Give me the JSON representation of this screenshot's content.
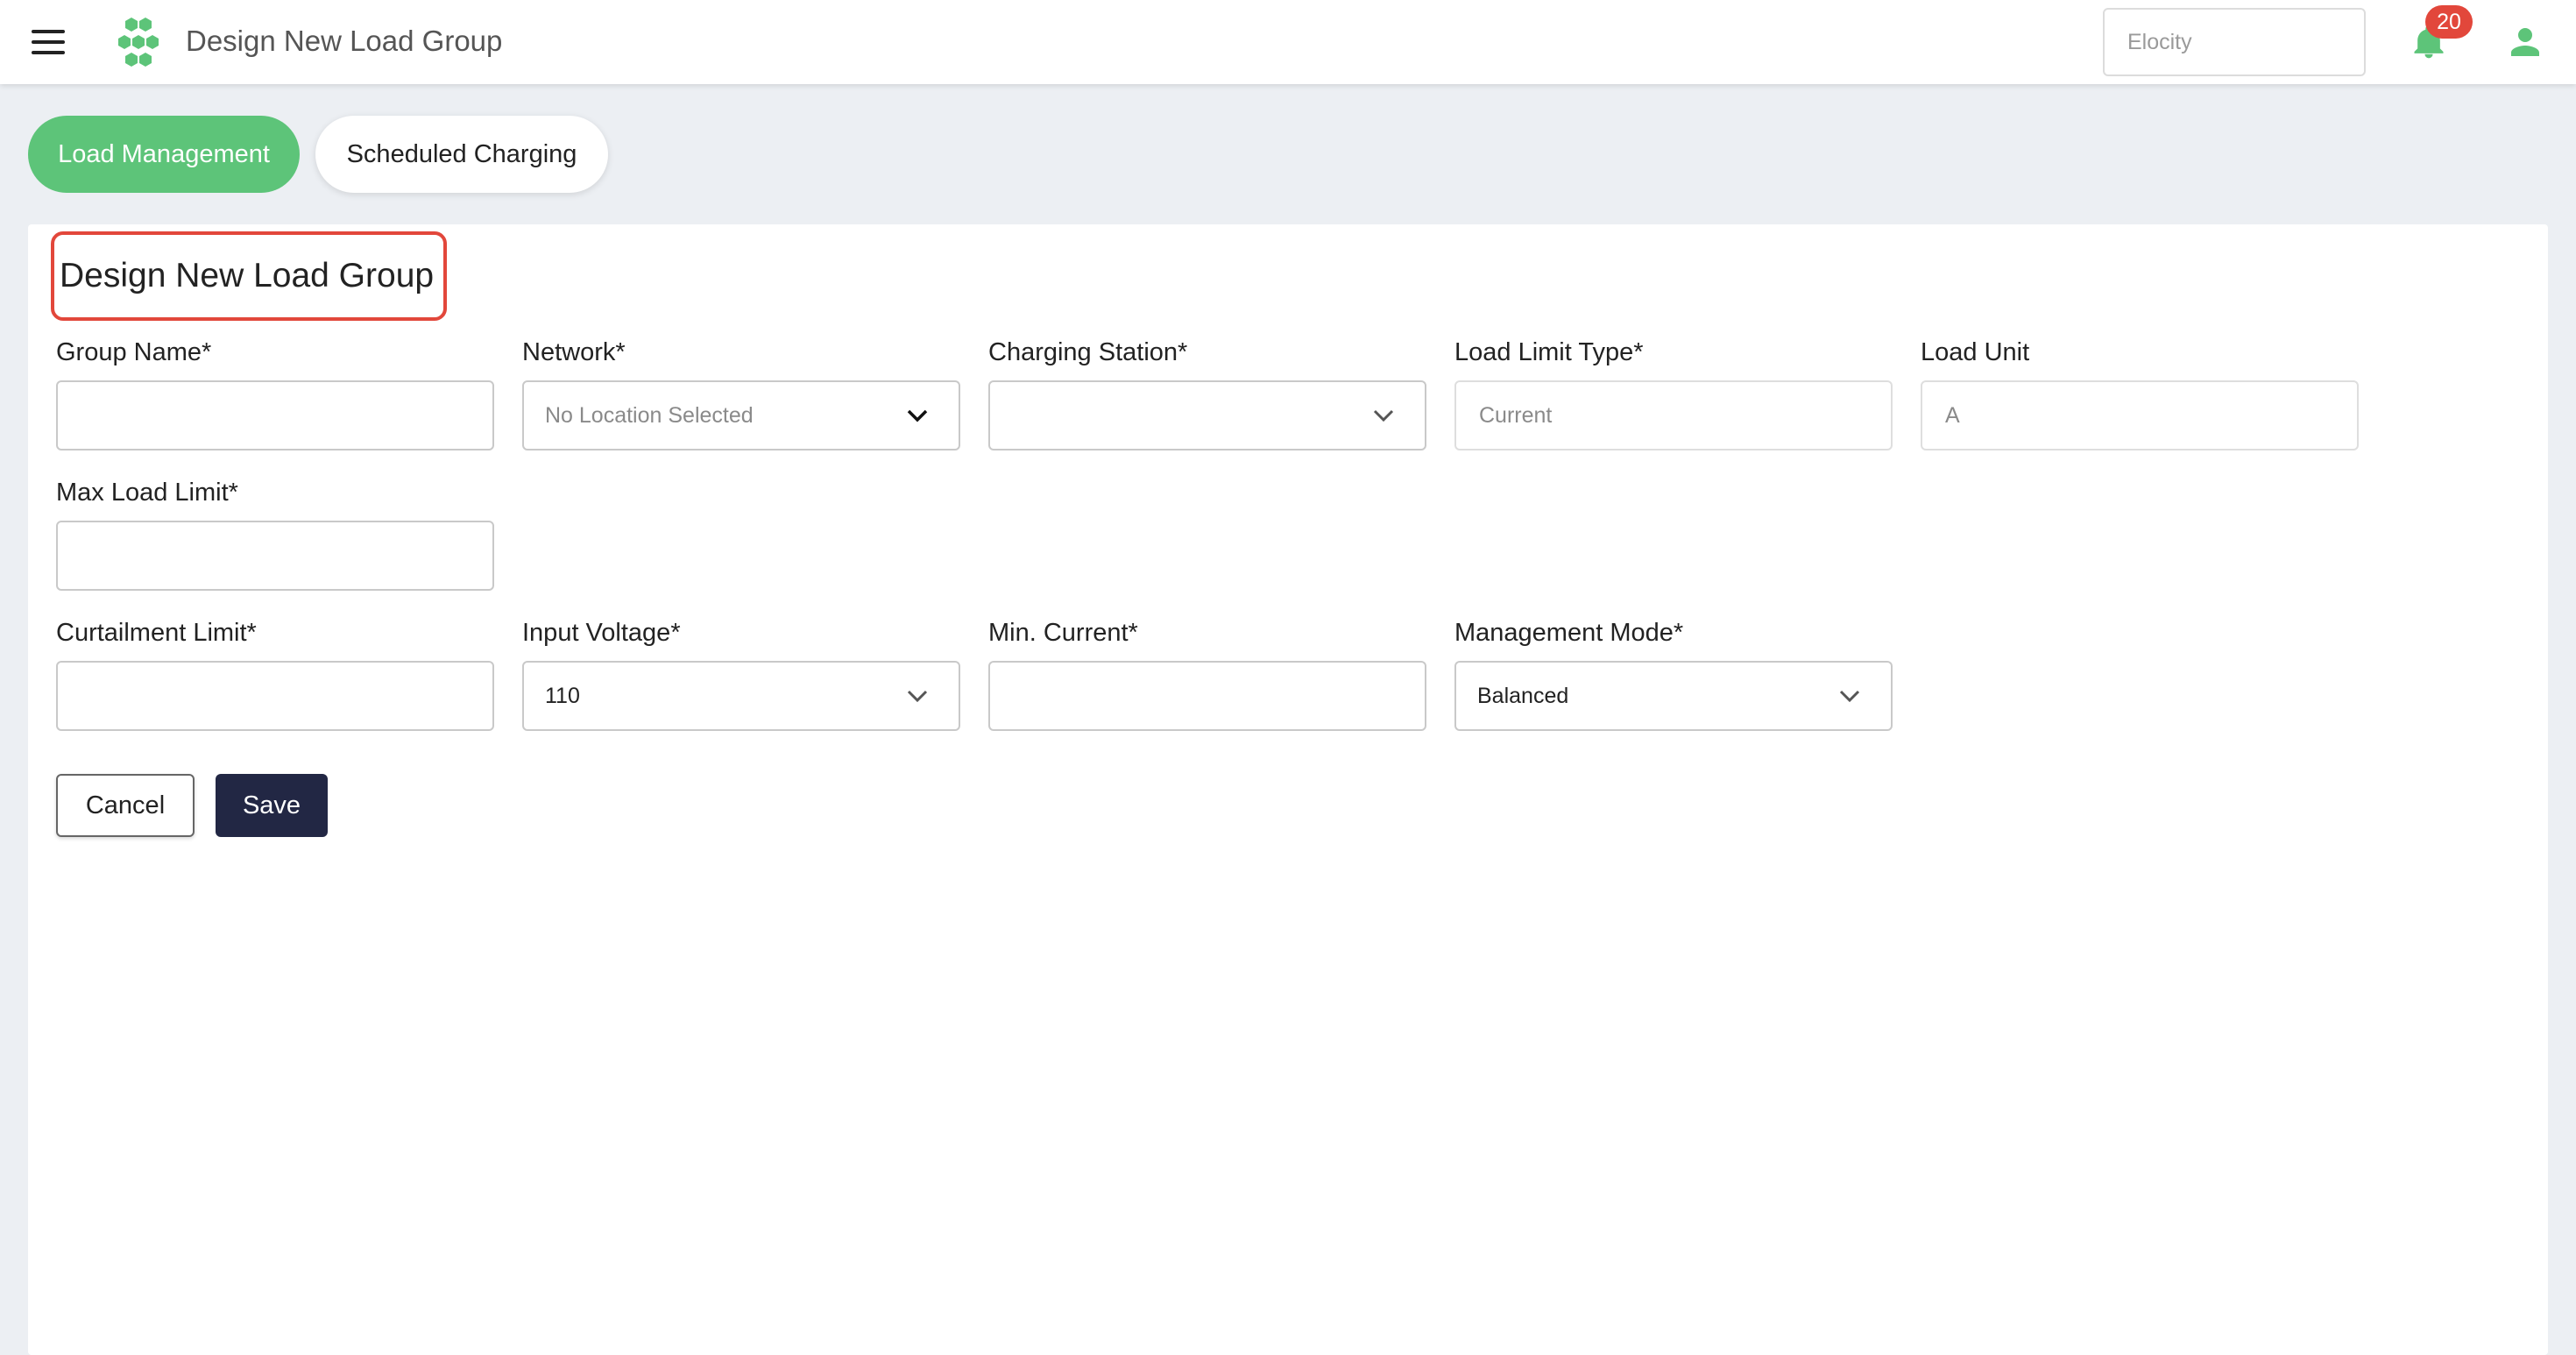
{
  "header": {
    "title": "Design New Load Group",
    "search_placeholder": "Elocity",
    "notification_count": "20",
    "brand_color": "#5dc479"
  },
  "tabs": [
    {
      "label": "Load Management",
      "active": true
    },
    {
      "label": "Scheduled Charging",
      "active": false
    }
  ],
  "form": {
    "title": "Design New Load Group",
    "group_name": {
      "label": "Group Name*",
      "value": ""
    },
    "network": {
      "label": "Network*",
      "value": "No Location Selected"
    },
    "charging_station": {
      "label": "Charging Station*",
      "value": ""
    },
    "load_limit_type": {
      "label": "Load Limit Type*",
      "placeholder": "Current"
    },
    "load_unit": {
      "label": "Load Unit",
      "placeholder": "A"
    },
    "max_load_limit": {
      "label": "Max Load Limit*",
      "value": ""
    },
    "curtailment_limit": {
      "label": "Curtailment Limit*",
      "value": ""
    },
    "input_voltage": {
      "label": "Input Voltage*",
      "value": "110"
    },
    "min_current": {
      "label": "Min. Current*",
      "value": ""
    },
    "management_mode": {
      "label": "Management Mode*",
      "value": "Balanced"
    }
  },
  "actions": {
    "cancel_label": "Cancel",
    "save_label": "Save"
  },
  "icons": {
    "menu": "hamburger-menu-icon",
    "logo": "hexagon-cluster-logo",
    "notifications": "bell-icon",
    "account": "user-icon",
    "dropdown": "chevron-down-icon"
  },
  "colors": {
    "accent": "#5dc479",
    "highlight": "#e2473b",
    "badge": "#e2473b",
    "primary_button": "#222744"
  }
}
